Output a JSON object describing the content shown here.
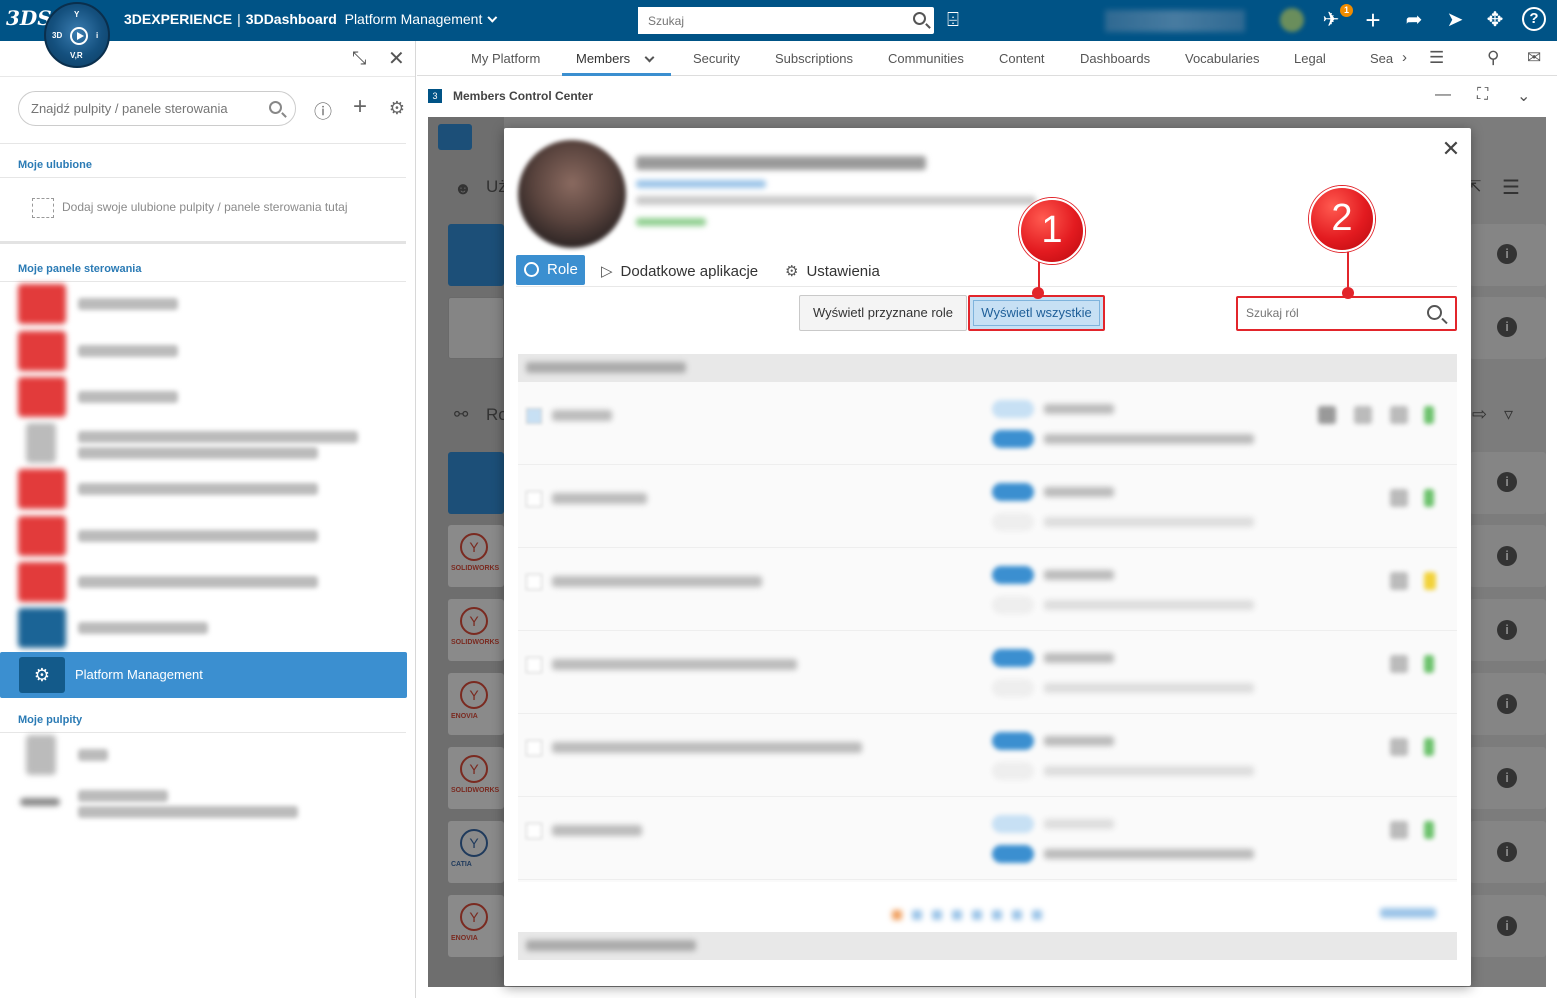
{
  "topbar": {
    "brand_logo": "3DS",
    "compass_labels": {
      "top": "Y",
      "left": "3D",
      "right": "i",
      "bottom": "V,R"
    },
    "app_brand": "3DEXPERIENCE",
    "separator": "|",
    "app_name": "3DDashboard",
    "context": "Platform Management",
    "search_placeholder": "Szukaj",
    "notification_count": "1",
    "icons": [
      "tag-icon",
      "notifications-icon",
      "add-icon",
      "share-icon",
      "social-icon",
      "compass-apps-icon",
      "help-icon"
    ]
  },
  "left_panel": {
    "search_placeholder": "Znajdź pulpity / panele sterowania",
    "favorites_header": "Moje ulubione",
    "favorites_hint": "Dodaj swoje ulubione pulpity / panele sterowania tutaj",
    "dashboards_header": "Moje panele sterowania",
    "active_dashboard": "Platform Management",
    "tabs_header": "Moje pulpity"
  },
  "nav_tabs": {
    "items": [
      "My Platform",
      "Members",
      "Security",
      "Subscriptions",
      "Communities",
      "Content",
      "Dashboards",
      "Vocabularies",
      "Legal",
      "Sea"
    ],
    "active": "Members"
  },
  "widget": {
    "title": "Members Control Center"
  },
  "background": {
    "users_label": "Uż",
    "roles_label": "Ro",
    "product_labels": [
      "SOLIDWORKS",
      "SOLIDWORKS",
      "ENOVIA",
      "SOLIDWORKS",
      "CATIA",
      "ENOVIA"
    ]
  },
  "modal": {
    "tabs": {
      "roles": "Role",
      "apps": "Dodatkowe aplikacje",
      "settings": "Ustawienia"
    },
    "filter_assigned": "Wyświetl przyznane role",
    "filter_all": "Wyświetl wszystkie",
    "search_placeholder": "Szukaj ról"
  },
  "annotations": {
    "callout_1": "1",
    "callout_2": "2"
  },
  "colors": {
    "topbar": "#005386",
    "accent": "#3b8fd0",
    "highlight": "#e2252b"
  }
}
